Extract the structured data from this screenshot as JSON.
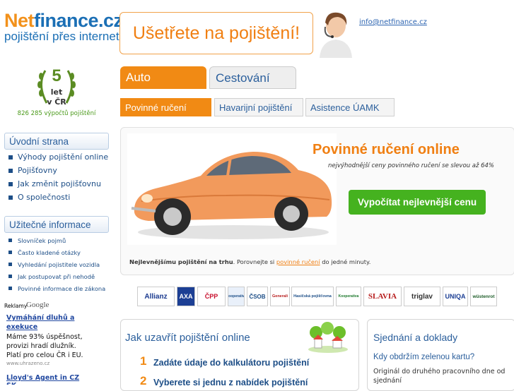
{
  "header": {
    "logo_net": "Net",
    "logo_rest": "finance.cz",
    "logo_sub": "pojištění přes internet",
    "slogan": "Ušetřete na pojištění!",
    "email": "info@netfinance.cz"
  },
  "badge": {
    "number": "5",
    "let": "let",
    "region": "v ČR",
    "count": "826 285 výpočtů pojištění"
  },
  "sidebar": {
    "section1_title": "Úvodní strana",
    "section1_items": [
      "Výhody pojištění online",
      "Pojišťovny",
      "Jak změnit pojišťovnu",
      "O společnosti"
    ],
    "section2_title": "Užitečné informace",
    "section2_items": [
      "Slovníček pojmů",
      "Často kladené otázky",
      "Vyhledání pojistitele vozidla",
      "Jak postupovat při nehodě",
      "Povinné informace dle zákona"
    ]
  },
  "ads": {
    "label": "Reklamy",
    "google": "Google",
    "ad1_title": "Vymáhání dluhů a exekuce",
    "ad1_text": "Máme 93% úspěšnost, provizi hradí dlužník. Platí pro celou ČR i EU.",
    "ad1_url": "www.uhrazeno.cz",
    "ad2_title": "Lloyd's Agent in CZ SK"
  },
  "tabs": {
    "main": [
      "Auto",
      "Cestování"
    ],
    "sub": [
      "Povinné ručení",
      "Havarijní pojištění",
      "Asistence ÚAMK"
    ]
  },
  "hero": {
    "title": "Povinné ručení online",
    "subtitle": "nejvýhodnější ceny povinného ručení se slevou až 64%",
    "cta": "Vypočítat nejlevnější cenu",
    "note_bold": "Nejlevnějšímu pojištění na trhu",
    "note_mid": ". Porovnejte si ",
    "note_link": "povinné ručení",
    "note_end": " do jedné minuty."
  },
  "insurers": [
    "Allianz",
    "AXA",
    "ČPP",
    "Kooperativa",
    "ČSOB",
    "Generali",
    "Hasičská pojišťovna",
    "Kooperativa",
    "SLAVIA",
    "triglav",
    "UNIQA",
    "wüstenrot"
  ],
  "how": {
    "title": "Jak uzavřít pojištění online",
    "steps": [
      {
        "num": "1",
        "text": "Zadáte údaje do kalkulátoru pojištění"
      },
      {
        "num": "2",
        "text": "Vyberete si jednu z nabídek pojištění"
      }
    ]
  },
  "docs": {
    "title": "Sjednání a doklady",
    "question": "Kdy obdržím zelenou kartu?",
    "answer": "Originál do druhého pracovního dne od sjednání"
  },
  "colors": {
    "orange": "#f18a14",
    "blue": "#2b5f9c",
    "green": "#45b21f"
  }
}
